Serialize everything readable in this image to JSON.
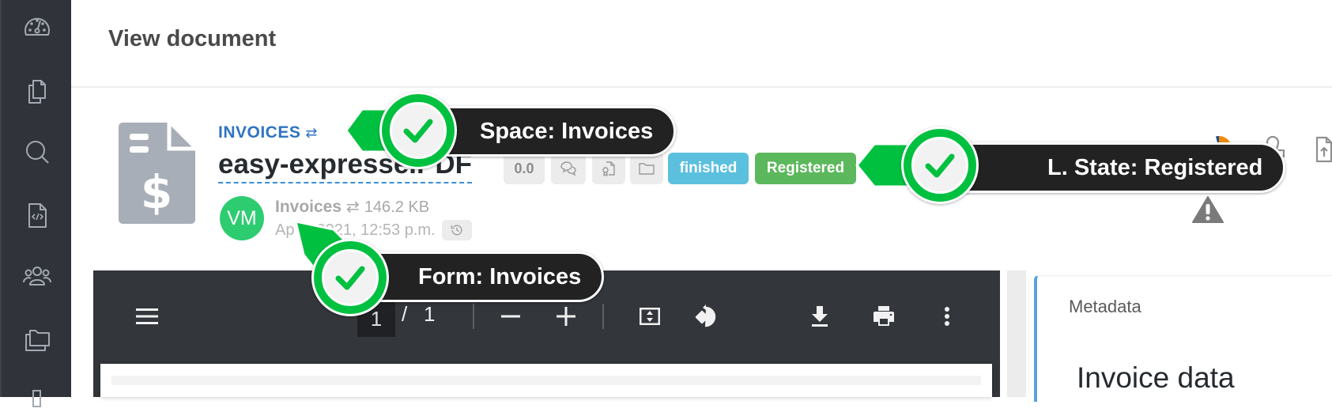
{
  "sidebar": {
    "items": [
      {
        "name": "dashboard",
        "icon": "speedometer-icon"
      },
      {
        "name": "documents",
        "icon": "copy-documents-icon"
      },
      {
        "name": "search",
        "icon": "search-icon"
      },
      {
        "name": "forms",
        "icon": "code-file-icon"
      },
      {
        "name": "users",
        "icon": "users-group-icon"
      },
      {
        "name": "folders",
        "icon": "folders-icon"
      },
      {
        "name": "more",
        "icon": "partial-icon"
      }
    ]
  },
  "header": {
    "title": "View document"
  },
  "document": {
    "space": "INVOICES",
    "space_swap_glyph": "⇄",
    "name": "easy-expresse.PDF",
    "rating": "0.0",
    "status_badge": "finished",
    "lifecycle_badge": "Registered",
    "avatar_initials": "VM",
    "form": "Invoices",
    "form_swap_glyph": "⇄",
    "size": "146.2 KB",
    "date": "Ap       2021, 12:53 p.m.",
    "colors": {
      "space_link": "#2f74c0",
      "finished": "#5bc0de",
      "registered": "#5cb85c",
      "avatar": "#2ecc71"
    }
  },
  "viewer": {
    "current_page": "1",
    "page_separator": "/",
    "total_pages": "1",
    "zoom_out": "−",
    "zoom_in": "+"
  },
  "metadata_panel": {
    "title": "Metadata",
    "section": "Invoice data"
  },
  "annotations": [
    {
      "label": "Space: Invoices",
      "color": "#00c040"
    },
    {
      "label": "L. State: Registered",
      "color": "#00c040"
    },
    {
      "label": "Form: Invoices",
      "color": "#00c040"
    }
  ]
}
